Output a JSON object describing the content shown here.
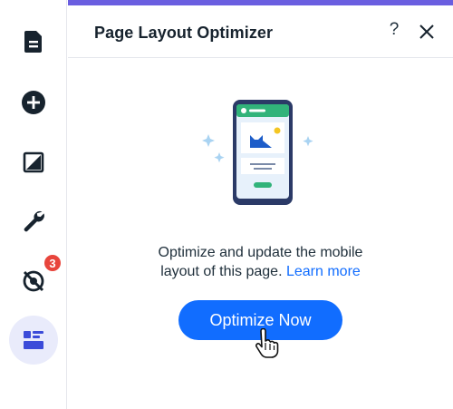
{
  "panel": {
    "title": "Page Layout Optimizer",
    "help_label": "?",
    "description_line1": "Optimize and update the mobile",
    "description_line2": "layout of this page.",
    "learn_more": "Learn more",
    "primary_button": "Optimize Now"
  },
  "rail": {
    "items": [
      {
        "icon": "page-icon"
      },
      {
        "icon": "add-icon"
      },
      {
        "icon": "design-icon"
      },
      {
        "icon": "wrench-icon"
      },
      {
        "icon": "hidden-elements-icon",
        "badge": "3"
      },
      {
        "icon": "layout-optimizer-icon",
        "active": true
      }
    ]
  },
  "colors": {
    "accent": "#6a5ee0",
    "button": "#116dff",
    "link": "#116dff",
    "badge": "#e8453c",
    "active_rail_bg": "#e9ebfb"
  }
}
